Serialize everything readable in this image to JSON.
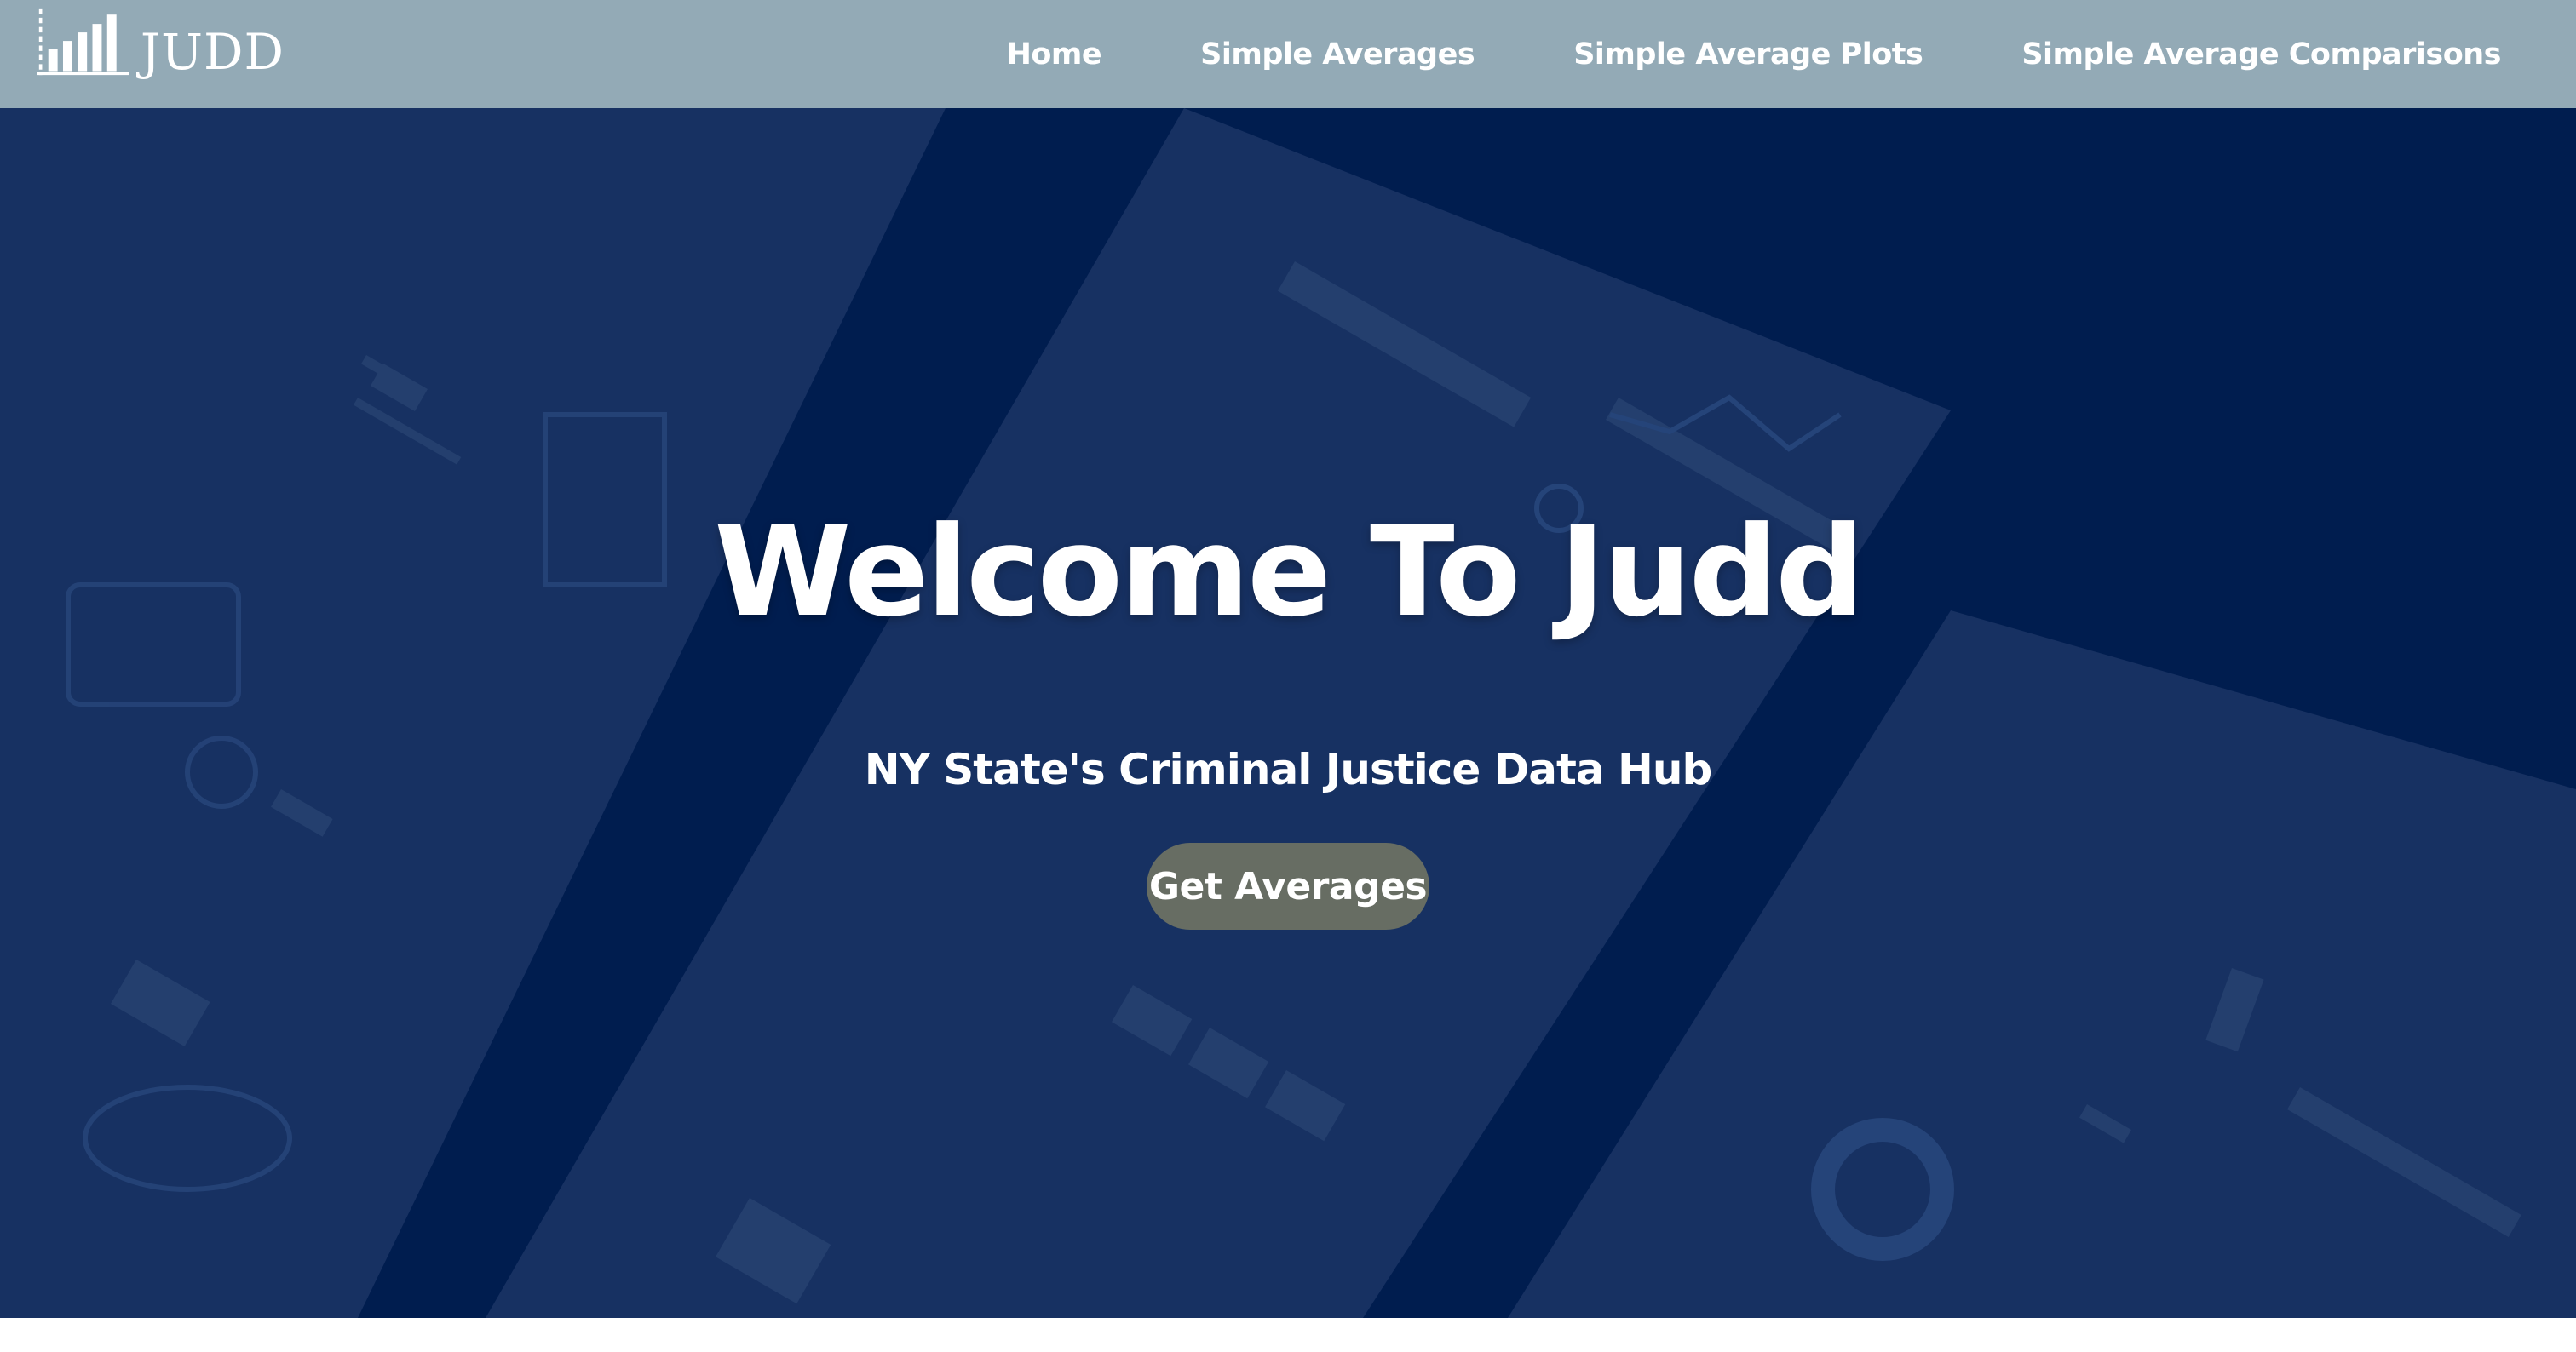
{
  "brand": {
    "name": "JUDD"
  },
  "nav": {
    "items": [
      {
        "label": "Home"
      },
      {
        "label": "Simple Averages"
      },
      {
        "label": "Simple Average Plots"
      },
      {
        "label": "Simple Average Comparisons"
      }
    ]
  },
  "hero": {
    "title": "Welcome To Judd",
    "subtitle": "NY State's Criminal Justice Data Hub",
    "cta_label": "Get Averages"
  },
  "colors": {
    "navbar": "#93aab6",
    "hero_background": "#001e50",
    "button": "#676d63",
    "text": "#ffffff"
  }
}
